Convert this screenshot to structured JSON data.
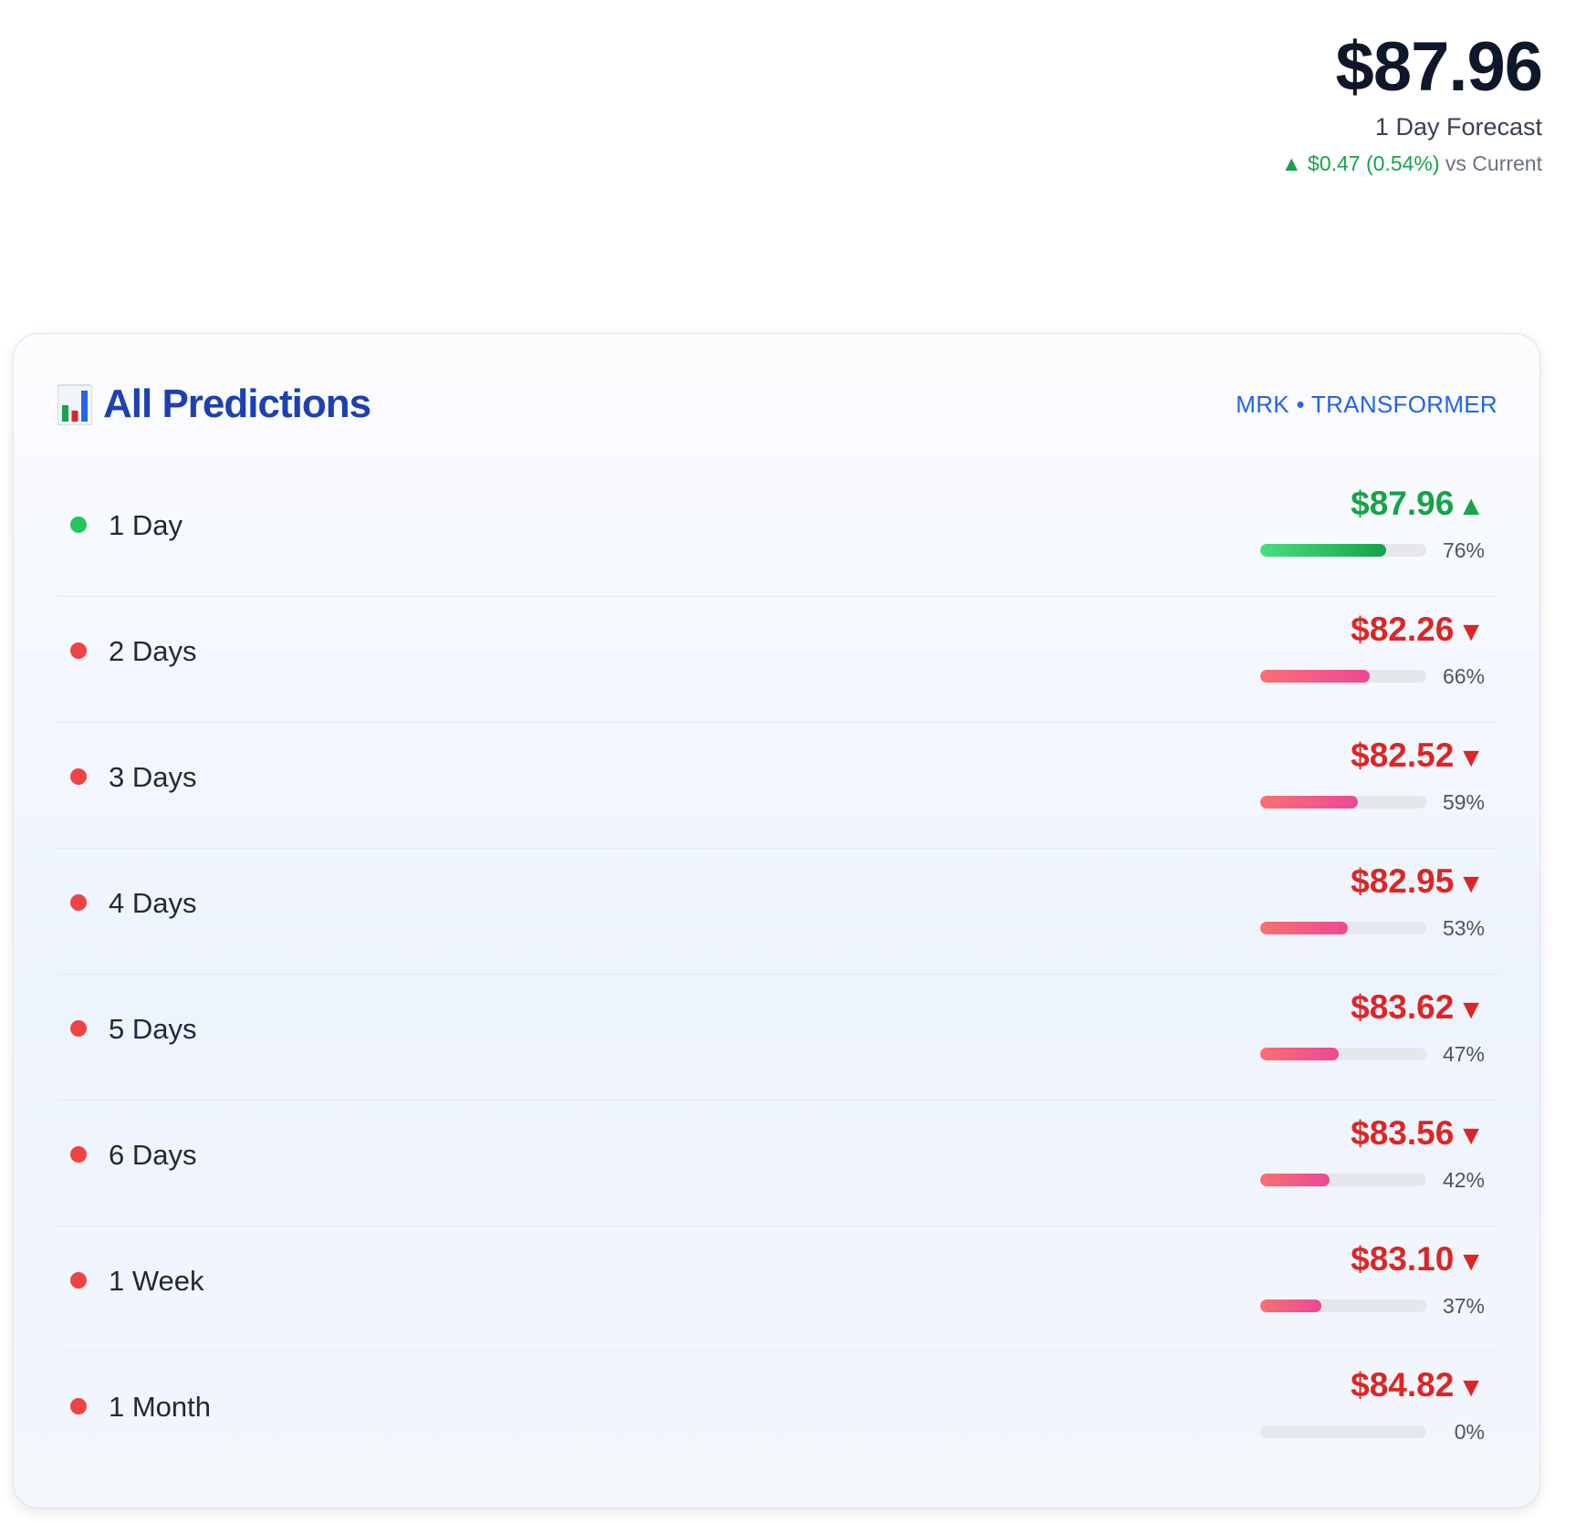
{
  "summary": {
    "price": "$87.96",
    "label": "1 Day Forecast",
    "change_arrow": "▲",
    "change_value": "$0.47 (0.54%)",
    "change_suffix": "vs Current"
  },
  "card": {
    "icon": "bar-chart-icon",
    "title": "All Predictions",
    "meta": "MRK • TRANSFORMER"
  },
  "colors": {
    "up": "#16a34a",
    "down": "#dc2626",
    "up_dot": "#22c55e",
    "down_dot": "#ef4444",
    "up_bar_start": "#4ade80",
    "up_bar_end": "#16a34a",
    "down_bar_start": "#f87171",
    "down_bar_end": "#ec4899"
  },
  "predictions": [
    {
      "horizon": "1 Day",
      "price": "$87.96",
      "direction": "up",
      "arrow": "▲",
      "confidence": 76,
      "confidence_label": "76%"
    },
    {
      "horizon": "2 Days",
      "price": "$82.26",
      "direction": "down",
      "arrow": "▼",
      "confidence": 66,
      "confidence_label": "66%"
    },
    {
      "horizon": "3 Days",
      "price": "$82.52",
      "direction": "down",
      "arrow": "▼",
      "confidence": 59,
      "confidence_label": "59%"
    },
    {
      "horizon": "4 Days",
      "price": "$82.95",
      "direction": "down",
      "arrow": "▼",
      "confidence": 53,
      "confidence_label": "53%"
    },
    {
      "horizon": "5 Days",
      "price": "$83.62",
      "direction": "down",
      "arrow": "▼",
      "confidence": 47,
      "confidence_label": "47%"
    },
    {
      "horizon": "6 Days",
      "price": "$83.56",
      "direction": "down",
      "arrow": "▼",
      "confidence": 42,
      "confidence_label": "42%"
    },
    {
      "horizon": "1 Week",
      "price": "$83.10",
      "direction": "down",
      "arrow": "▼",
      "confidence": 37,
      "confidence_label": "37%"
    },
    {
      "horizon": "1 Month",
      "price": "$84.82",
      "direction": "down",
      "arrow": "▼",
      "confidence": 0,
      "confidence_label": "0%"
    }
  ]
}
